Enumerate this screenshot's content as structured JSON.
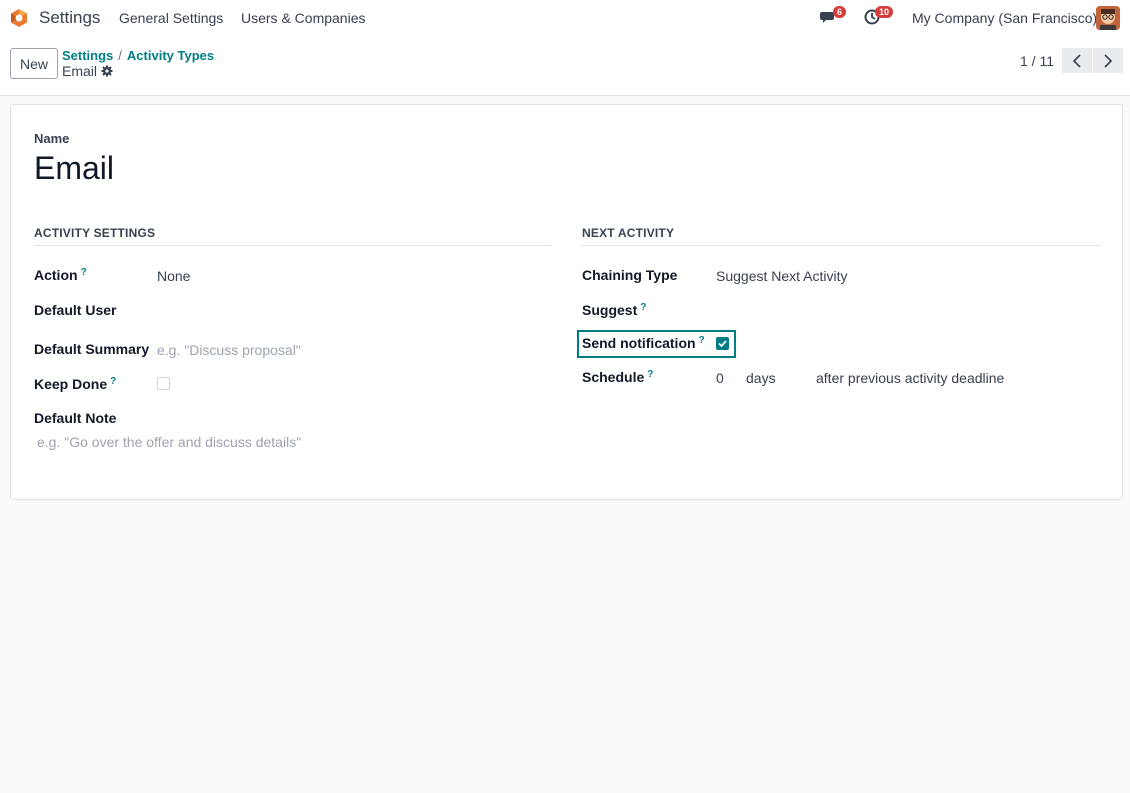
{
  "navbar": {
    "app_name": "Settings",
    "menu_general": "General Settings",
    "menu_users": "Users & Companies",
    "messages_count": "6",
    "activities_count": "10",
    "company": "My Company (San Francisco)"
  },
  "control_panel": {
    "new_label": "New",
    "breadcrumb_settings": "Settings",
    "breadcrumb_sep": "/",
    "breadcrumb_activity_types": "Activity Types",
    "record_name": "Email",
    "pager": "1 / 11"
  },
  "form": {
    "name_label": "Name",
    "name_value": "Email",
    "activity_settings": {
      "title": "ACTIVITY SETTINGS",
      "action_label": "Action",
      "action_value": "None",
      "default_user_label": "Default User",
      "default_summary_label": "Default Summary",
      "default_summary_placeholder": "e.g. \"Discuss proposal\"",
      "keep_done_label": "Keep Done",
      "default_note_label": "Default Note",
      "default_note_placeholder": "e.g. \"Go over the offer and discuss details\""
    },
    "next_activity": {
      "title": "NEXT ACTIVITY",
      "chaining_type_label": "Chaining Type",
      "chaining_type_value": "Suggest Next Activity",
      "suggest_label": "Suggest",
      "send_notification_label": "Send notification",
      "schedule_label": "Schedule",
      "schedule_value": "0",
      "schedule_unit": "days",
      "schedule_relation": "after previous activity deadline"
    },
    "help_mark": "?"
  },
  "colors": {
    "accent": "#017e84",
    "badge": "#d63c3c"
  }
}
